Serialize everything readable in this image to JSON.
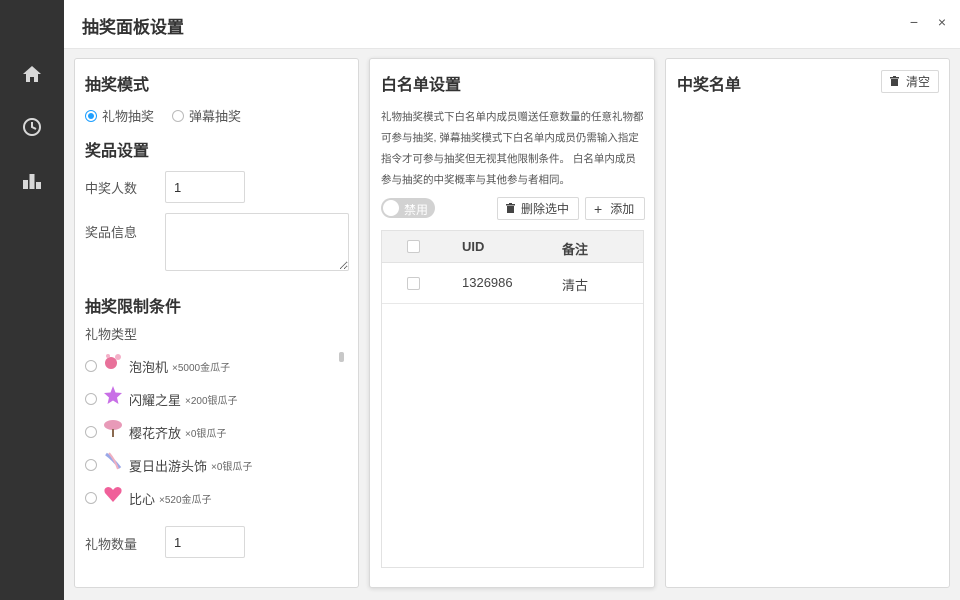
{
  "header": {
    "title": "抽奖面板设置",
    "minimize": "−",
    "close": "×"
  },
  "sidebar": {
    "items": [
      {
        "icon": "home-icon"
      },
      {
        "icon": "clock-icon"
      },
      {
        "icon": "chart-icon"
      }
    ]
  },
  "left_panel": {
    "mode_title": "抽奖模式",
    "mode_options": [
      {
        "label": "礼物抽奖",
        "checked": true
      },
      {
        "label": "弹幕抽奖",
        "checked": false
      }
    ],
    "prize_title": "奖品设置",
    "winner_count_label": "中奖人数",
    "winner_count_value": "1",
    "prize_info_label": "奖品信息",
    "prize_info_value": "",
    "limit_title": "抽奖限制条件",
    "gift_type_label": "礼物类型",
    "gifts": [
      {
        "name": "泡泡机",
        "price": "×5000金瓜子",
        "icon": "bubble-machine-icon",
        "color": "#e8719a"
      },
      {
        "name": "闪耀之星",
        "price": "×200银瓜子",
        "icon": "shining-star-icon",
        "color": "#c86fe6"
      },
      {
        "name": "樱花齐放",
        "price": "×0银瓜子",
        "icon": "cherry-blossom-icon",
        "color": "#e89ab8"
      },
      {
        "name": "夏日出游头饰",
        "price": "×0银瓜子",
        "icon": "summer-headwear-icon",
        "color": "#9aa8e8"
      },
      {
        "name": "比心",
        "price": "×520金瓜子",
        "icon": "heart-icon",
        "color": "#f0609a"
      }
    ],
    "gift_count_label": "礼物数量",
    "gift_count_value": "1"
  },
  "whitelist_panel": {
    "title": "白名单设置",
    "description": "礼物抽奖模式下白名单内成员赠送任意数量的任意礼物都可参与抽奖, 弹幕抽奖模式下白名单内成员仍需输入指定指令才可参与抽奖但无视其他限制条件。 白名单内成员参与抽奖的中奖概率与其他参与者相同。",
    "toggle_label": "禁用",
    "delete_button": "删除选中",
    "add_button": "添加",
    "columns": [
      "UID",
      "备注"
    ],
    "rows": [
      {
        "uid": "1326986",
        "note": "清古"
      }
    ]
  },
  "winners_panel": {
    "title": "中奖名单",
    "clear_button": "清空"
  },
  "colors": {
    "sidebar": "#333333",
    "accent": "#1e9fff",
    "panel_border": "#d9d9d9"
  }
}
